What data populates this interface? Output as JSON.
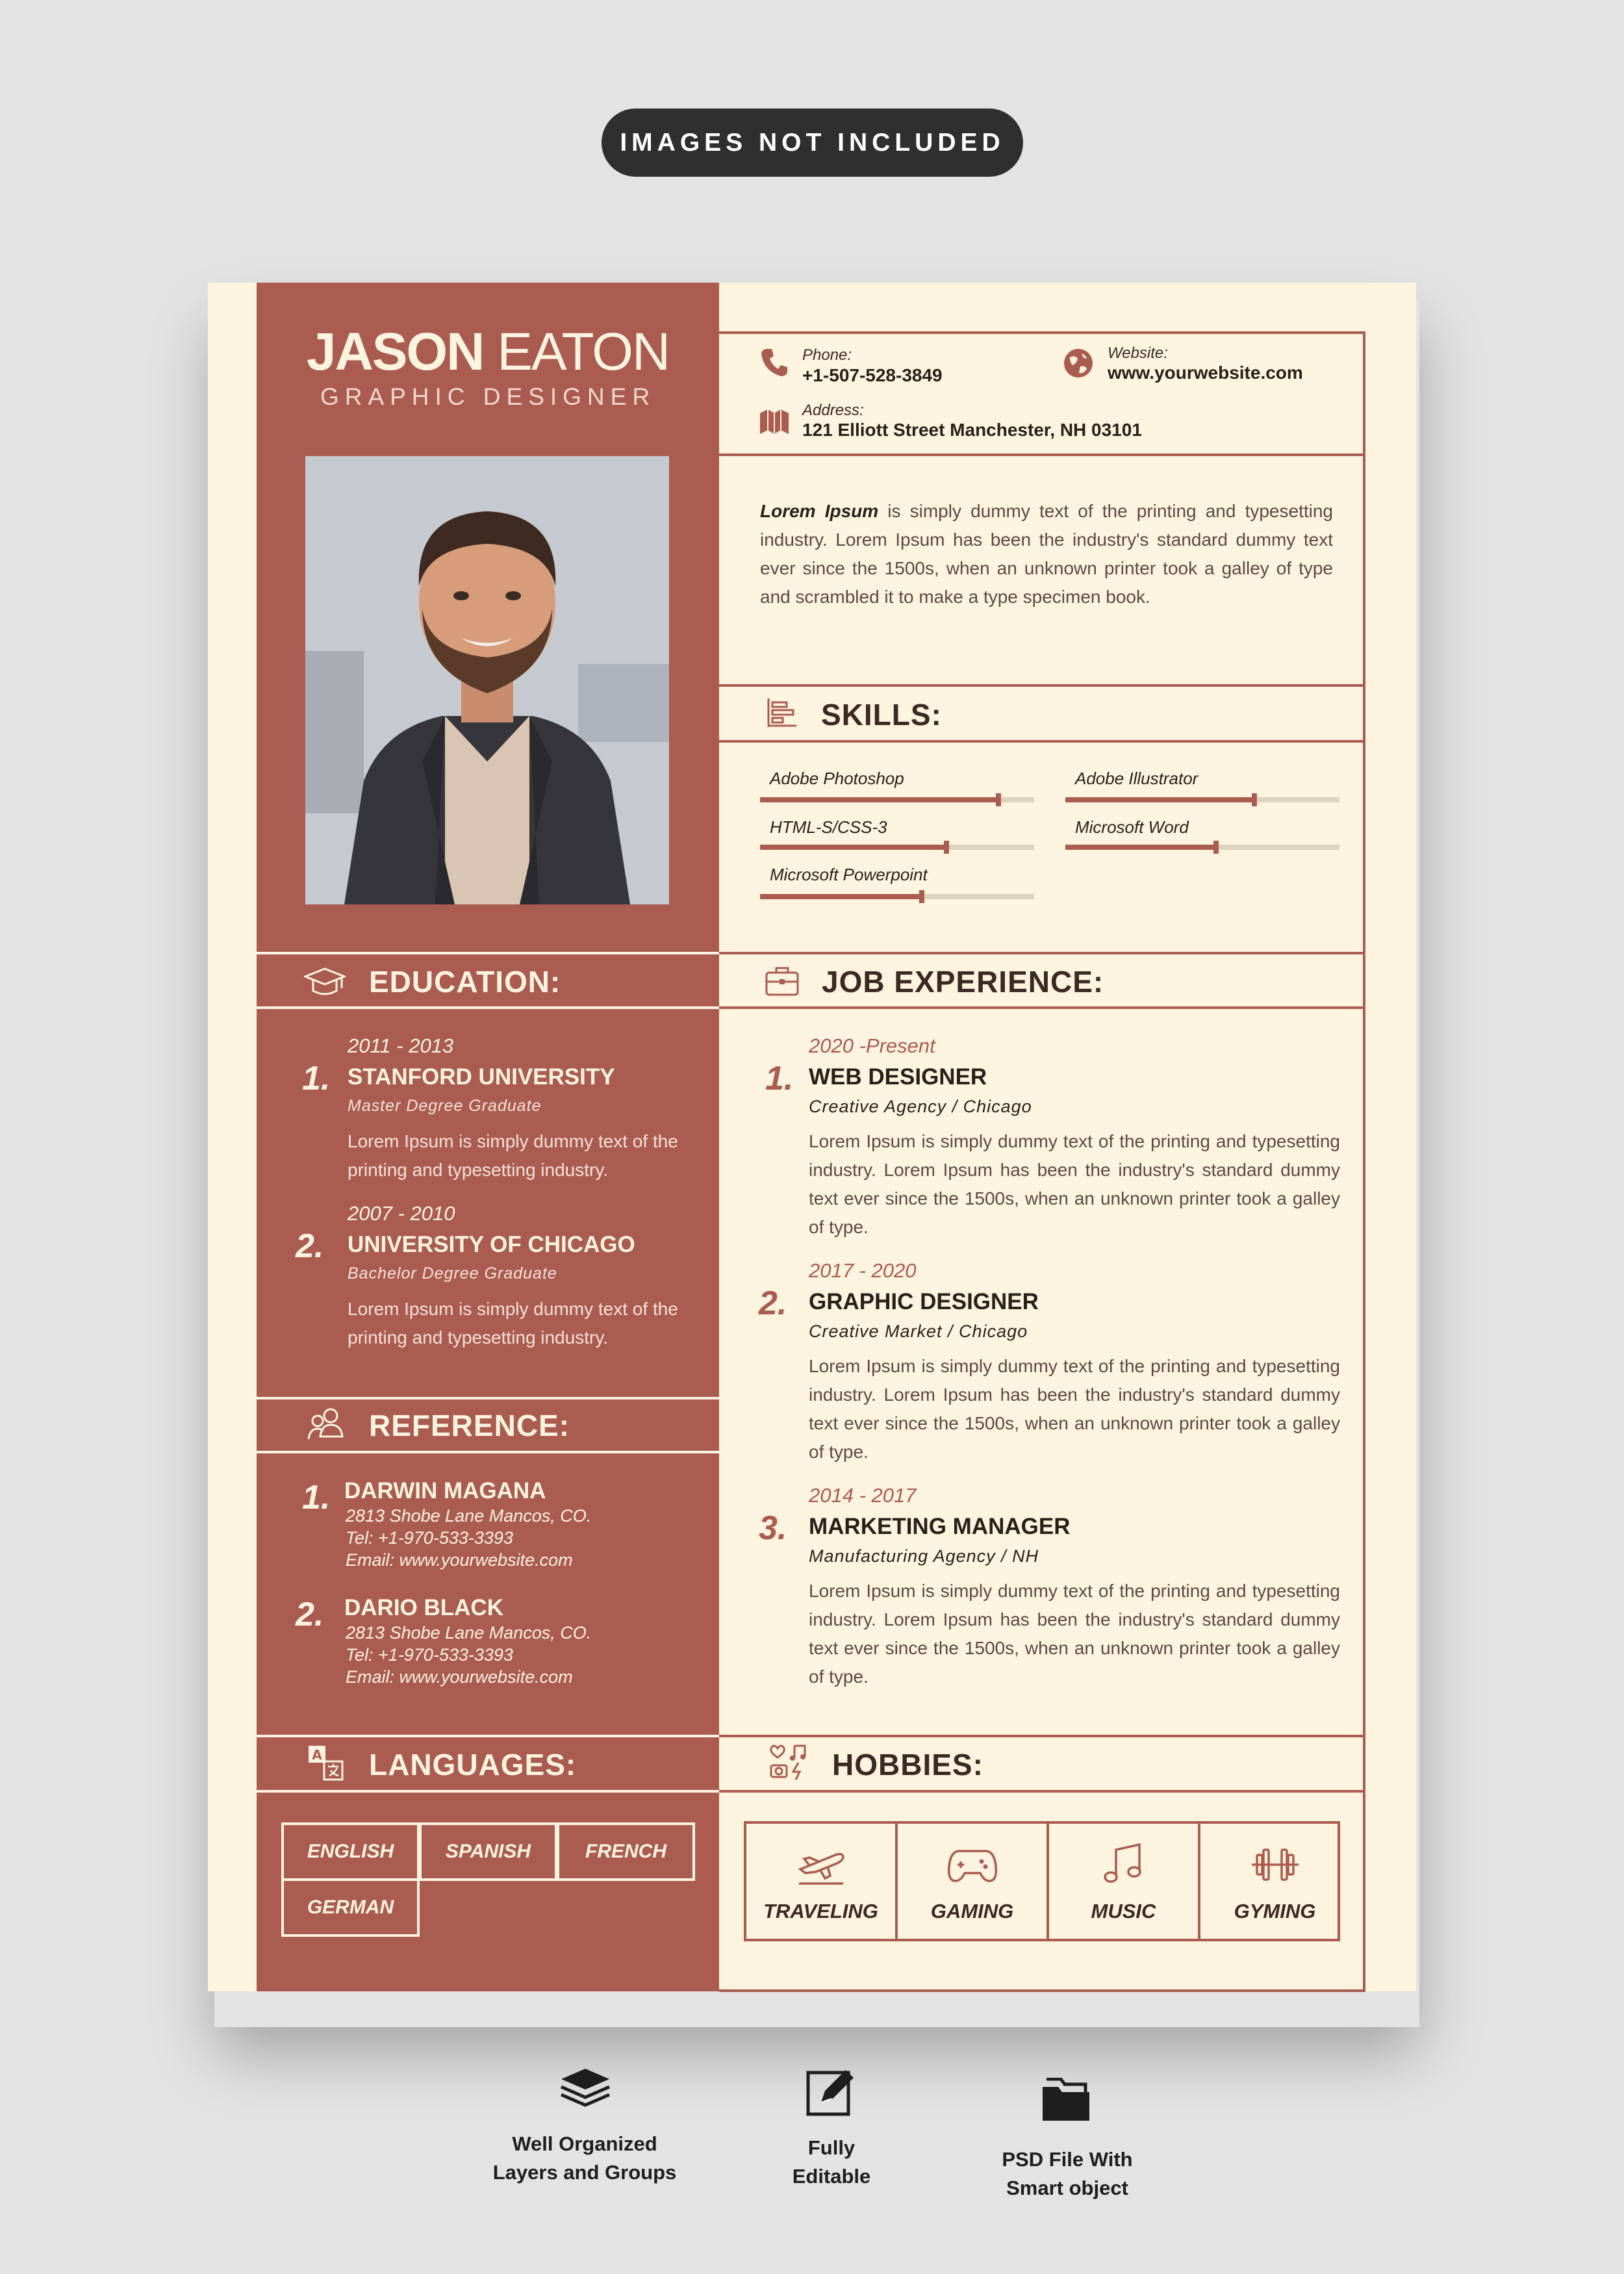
{
  "banner": {
    "label": "IMAGES NOT INCLUDED"
  },
  "header": {
    "first_name": "JASON",
    "last_name": "EATON",
    "role": "GRAPHIC DESIGNER"
  },
  "contact": {
    "phone_label": "Phone:",
    "phone": "+1-507-528-3849",
    "website_label": "Website:",
    "website": "www.yourwebsite.com",
    "address_label": "Address:",
    "address": "121 Elliott Street Manchester, NH 03101"
  },
  "about": {
    "lead": "Lorem Ipsum",
    "text": " is simply dummy text of the printing and typesetting industry. Lorem Ipsum has been the industry's standard dummy text ever since the 1500s, when an unknown printer took a galley of type and scrambled it to make a type specimen book."
  },
  "skills": {
    "title": "SKILLS:",
    "items": [
      {
        "label": "Adobe Photoshop",
        "level": 0.87
      },
      {
        "label": "Adobe Illustrator",
        "level": 0.69
      },
      {
        "label": "HTML-S/CSS-3",
        "level": 0.68
      },
      {
        "label": "Microsoft Word",
        "level": 0.55
      },
      {
        "label": "Microsoft Powerpoint",
        "level": 0.59
      }
    ]
  },
  "education": {
    "title": "EDUCATION:",
    "items": [
      {
        "num": "1.",
        "years": "2011 - 2013",
        "school": "STANFORD UNIVERSITY",
        "degree": "Master Degree Graduate",
        "desc": "Lorem Ipsum is simply dummy text of the printing and typesetting industry."
      },
      {
        "num": "2.",
        "years": "2007 - 2010",
        "school": "UNIVERSITY OF CHICAGO",
        "degree": "Bachelor Degree Graduate",
        "desc": "Lorem Ipsum is simply dummy text of the printing and typesetting industry."
      }
    ]
  },
  "reference": {
    "title": "REFERENCE:",
    "items": [
      {
        "num": "1.",
        "name": "DARWIN MAGANA",
        "address": "2813 Shobe Lane Mancos, CO.",
        "tel": "Tel: +1-970-533-3393",
        "email": "Email: www.yourwebsite.com"
      },
      {
        "num": "2.",
        "name": "DARIO BLACK",
        "address": "2813 Shobe Lane Mancos, CO.",
        "tel": "Tel: +1-970-533-3393",
        "email": "Email: www.yourwebsite.com"
      }
    ]
  },
  "experience": {
    "title": "JOB EXPERIENCE:",
    "items": [
      {
        "num": "1.",
        "years": "2020 -Present",
        "title": "WEB DESIGNER",
        "company": "Creative Agency / Chicago",
        "desc": "Lorem Ipsum is simply dummy text of the printing and typesetting industry. Lorem Ipsum has been the industry's standard dummy text ever since the 1500s, when an unknown printer took a galley of type."
      },
      {
        "num": "2.",
        "years": "2017 - 2020",
        "title": "GRAPHIC DESIGNER",
        "company": "Creative Market / Chicago",
        "desc": "Lorem Ipsum is simply dummy text of the printing and typesetting industry. Lorem Ipsum has been the industry's standard dummy text ever since the 1500s, when an unknown printer took a galley of type."
      },
      {
        "num": "3.",
        "years": "2014 - 2017",
        "title": "MARKETING MANAGER",
        "company": "Manufacturing Agency / NH",
        "desc": "Lorem Ipsum is simply dummy text of the printing and typesetting industry. Lorem Ipsum has been the industry's standard dummy text ever since the 1500s, when an unknown printer took a galley of type."
      }
    ]
  },
  "languages": {
    "title": "LANGUAGES:",
    "items": [
      "ENGLISH",
      "SPANISH",
      "FRENCH",
      "GERMAN"
    ]
  },
  "hobbies": {
    "title": "HOBBIES:",
    "items": [
      "TRAVELING",
      "GAMING",
      "MUSIC",
      "GYMING"
    ]
  },
  "features": [
    {
      "line1": "Well Organized",
      "line2": "Layers and Groups"
    },
    {
      "line1": "Fully",
      "line2": "Editable"
    },
    {
      "line1": "PSD File With",
      "line2": "Smart object"
    }
  ],
  "colors": {
    "accent": "#ab5c51",
    "paper": "#fdf4df",
    "dark": "#2b1f1a",
    "background": "#e3e3e3"
  }
}
